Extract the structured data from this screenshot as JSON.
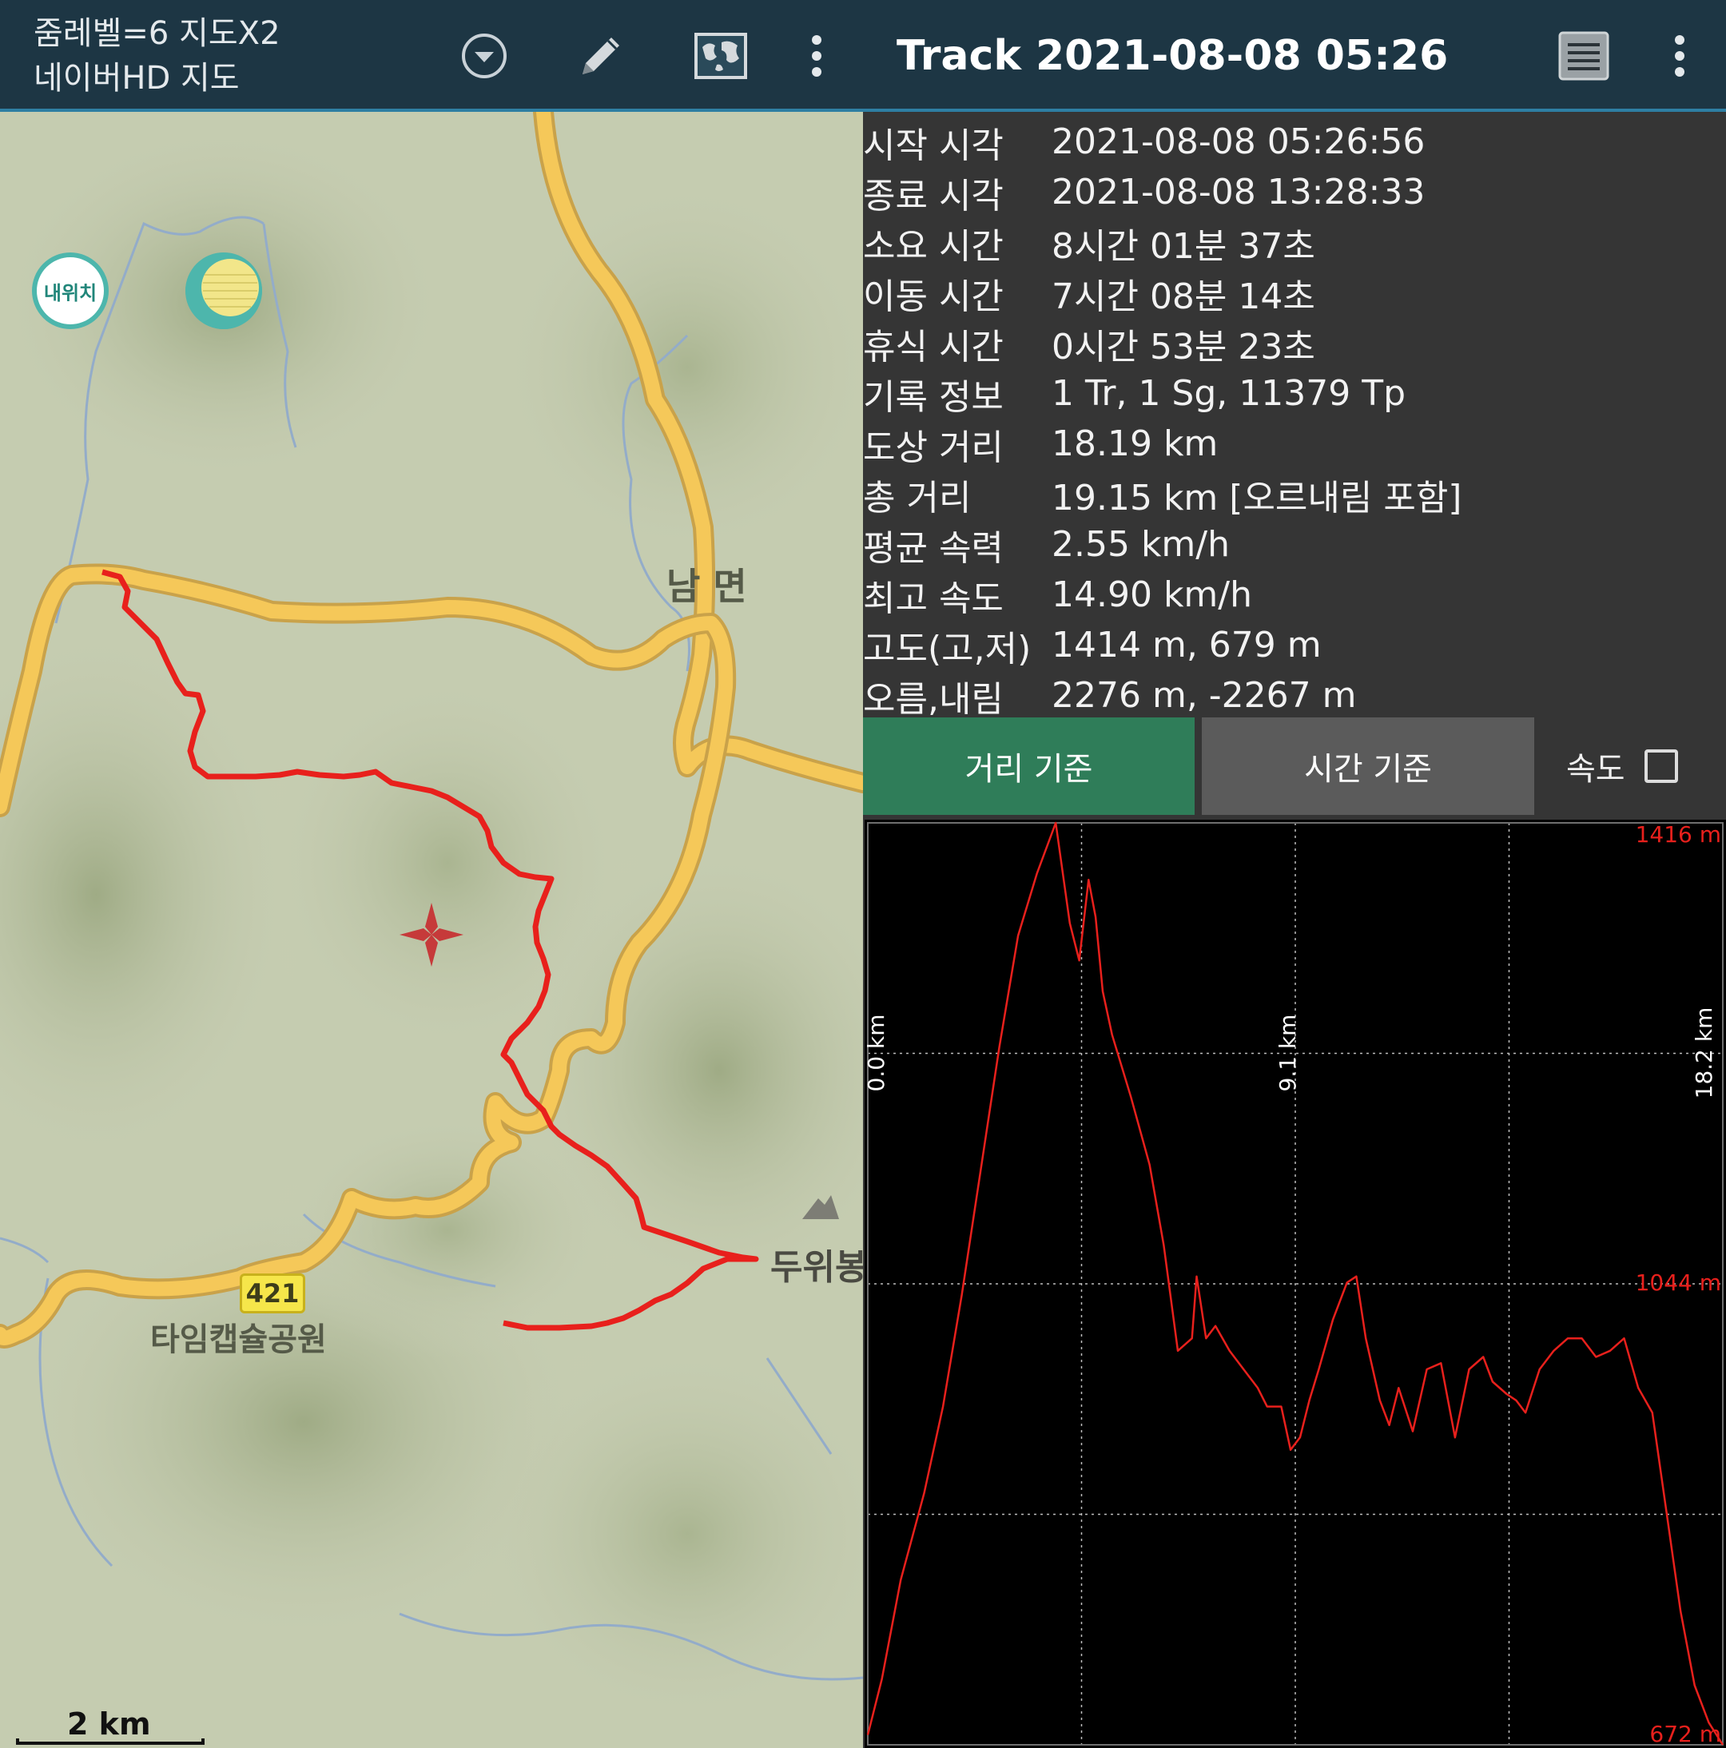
{
  "header": {
    "zoom_text": "줌레벨=6 지도X2",
    "map_name": "네이버HD 지도",
    "track_title": "Track 2021-08-08 05:26"
  },
  "map": {
    "my_location_label": "내위치",
    "labels": {
      "town": "남 면",
      "peak": "두위봉",
      "park": "타임캡슐공원"
    },
    "road_number": "421",
    "scale_label": "2 km"
  },
  "stats": [
    {
      "label": "시작 시각",
      "value": "2021-08-08 05:26:56"
    },
    {
      "label": "종료 시각",
      "value": "2021-08-08 13:28:33"
    },
    {
      "label": "소요 시간",
      "value": "8시간 01분 37초"
    },
    {
      "label": "이동 시간",
      "value": "7시간 08분 14초"
    },
    {
      "label": "휴식 시간",
      "value": "0시간 53분 23초"
    },
    {
      "label": "기록 정보",
      "value": "1 Tr, 1 Sg, 11379 Tp"
    },
    {
      "label": "도상 거리",
      "value": "18.19 km"
    },
    {
      "label": "총 거리",
      "value": "19.15 km [오르내림 포함]"
    },
    {
      "label": "평균 속력",
      "value": "2.55 km/h"
    },
    {
      "label": "최고 속도",
      "value": "14.90 km/h"
    },
    {
      "label": "고도(고,저)",
      "value": "1414 m, 679 m"
    },
    {
      "label": "오름,내림",
      "value": "2276 m, -2267 m"
    }
  ],
  "tabs": {
    "distance": "거리 기준",
    "time": "시간 기준",
    "speed_label": "속도",
    "speed_checked": false
  },
  "colors": {
    "topbar": "#1d3644",
    "track": "#e8201c",
    "road": "#f5c859",
    "tab_active": "#2f7d59",
    "tab_inactive": "#5b5b5b"
  },
  "chart_data": {
    "type": "line",
    "x_ticks": [
      "0.0 km",
      "9.1 km",
      "18.2 km"
    ],
    "y_ticks": [
      "1416 m",
      "1044 m",
      "672 m"
    ],
    "xlim": [
      0,
      18.2
    ],
    "ylim": [
      672,
      1416
    ],
    "grid": true,
    "series": [
      {
        "x": [
          0,
          0.3,
          0.7,
          1.2,
          1.6,
          2.0,
          2.4,
          2.8,
          3.2,
          3.6,
          4.0,
          4.3,
          4.5,
          4.7,
          4.85,
          5.0,
          5.2,
          5.6,
          6.0,
          6.3,
          6.6,
          6.9,
          7.0,
          7.2,
          7.4,
          7.7,
          8.0,
          8.3,
          8.5,
          8.8,
          9.0,
          9.2,
          9.4,
          9.6,
          9.9,
          10.2,
          10.4,
          10.6,
          10.9,
          11.1,
          11.3,
          11.6,
          11.9,
          12.2,
          12.5,
          12.8,
          13.1,
          13.3,
          13.6,
          13.8,
          14.0,
          14.3,
          14.6,
          14.9,
          15.2,
          15.5,
          15.8,
          16.1,
          16.4,
          16.7,
          17.0,
          17.3,
          17.6,
          17.9,
          18.2
        ],
        "y": [
          680,
          725,
          805,
          875,
          945,
          1035,
          1135,
          1235,
          1325,
          1375,
          1416,
          1335,
          1305,
          1370,
          1340,
          1280,
          1245,
          1195,
          1140,
          1075,
          990,
          1000,
          1050,
          1000,
          1010,
          990,
          975,
          960,
          945,
          945,
          910,
          920,
          950,
          975,
          1015,
          1045,
          1050,
          1000,
          950,
          930,
          960,
          925,
          975,
          980,
          920,
          975,
          985,
          965,
          955,
          950,
          940,
          975,
          990,
          1000,
          1000,
          985,
          990,
          1000,
          960,
          940,
          860,
          780,
          720,
          690,
          672
        ]
      }
    ]
  }
}
